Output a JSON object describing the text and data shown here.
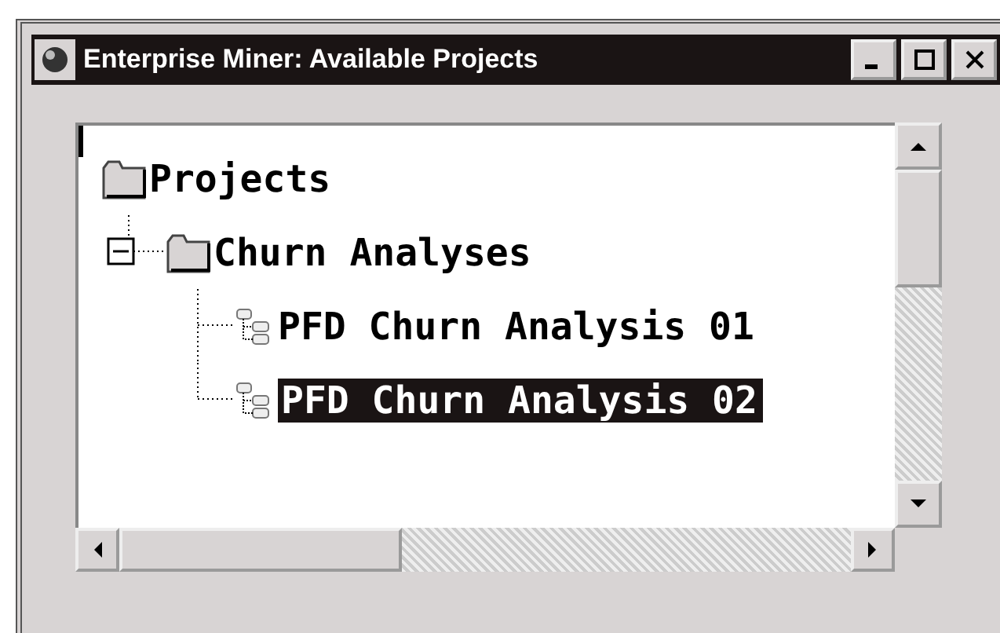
{
  "window": {
    "title": "Enterprise Miner: Available Projects"
  },
  "tree": [
    {
      "label": "Projects",
      "kind": "folder",
      "selected": false,
      "children": [
        {
          "label": "Churn Analyses",
          "kind": "folder",
          "selected": false,
          "expanded": true,
          "children": [
            {
              "label": "PFD Churn Analysis 01",
              "kind": "diagram",
              "selected": false
            },
            {
              "label": "PFD Churn Analysis 02",
              "kind": "diagram",
              "selected": true
            }
          ]
        }
      ]
    }
  ]
}
